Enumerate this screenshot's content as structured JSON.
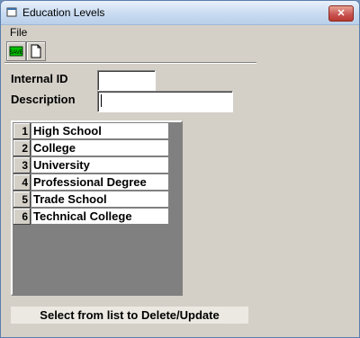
{
  "window": {
    "title": "Education Levels",
    "close_label": "✕"
  },
  "menu": {
    "file_label": "File"
  },
  "toolbar": {
    "save_icon": "save-icon",
    "new_icon": "new-document-icon",
    "save_text": "SAVE"
  },
  "form": {
    "internal_id_label": "Internal ID",
    "internal_id_value": "",
    "description_label": "Description",
    "description_value": ""
  },
  "list": {
    "rows": [
      {
        "num": "1",
        "text": "High School"
      },
      {
        "num": "2",
        "text": "College"
      },
      {
        "num": "3",
        "text": "University"
      },
      {
        "num": "4",
        "text": "Professional Degree"
      },
      {
        "num": "5",
        "text": "Trade School"
      },
      {
        "num": "6",
        "text": "Technical College"
      }
    ]
  },
  "status": {
    "text": "Select from list to Delete/Update"
  }
}
